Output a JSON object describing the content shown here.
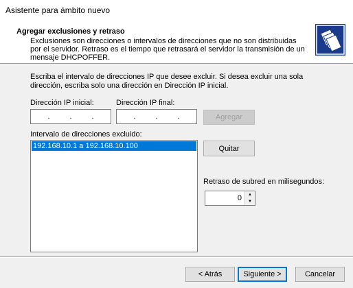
{
  "window": {
    "title": "Asistente para ámbito nuevo"
  },
  "header": {
    "title": "Agregar exclusiones y retraso",
    "description": "Exclusiones son direcciones o intervalos de direcciones que no son distribuidas por el servidor. Retraso es el tiempo que retrasará el servidor la transmisión de un mensaje DHCPOFFER."
  },
  "instructions": "Escriba el intervalo de direcciones IP que desee excluir. Si desea excluir una sola dirección, escriba solo una dirección en Dirección IP inicial.",
  "start_ip": {
    "label": "Dirección IP inicial:",
    "dots": [
      ".",
      ".",
      "."
    ]
  },
  "end_ip": {
    "label": "Dirección IP final:",
    "dots": [
      ".",
      ".",
      "."
    ]
  },
  "add_button": "Agregar",
  "excluded_range": {
    "label": "Intervalo de direcciones excluido:",
    "items": [
      "192.168.10.1 a 192.168.10.100"
    ]
  },
  "remove_button": "Quitar",
  "delay": {
    "label": "Retraso de subred en milisegundos:",
    "value": "0"
  },
  "footer": {
    "back": "< Atrás",
    "next": "Siguiente >",
    "cancel": "Cancelar"
  },
  "icons": {
    "header_icon": "folders-icon",
    "spin_up": "arrow-up-icon",
    "spin_down": "arrow-down-icon"
  }
}
